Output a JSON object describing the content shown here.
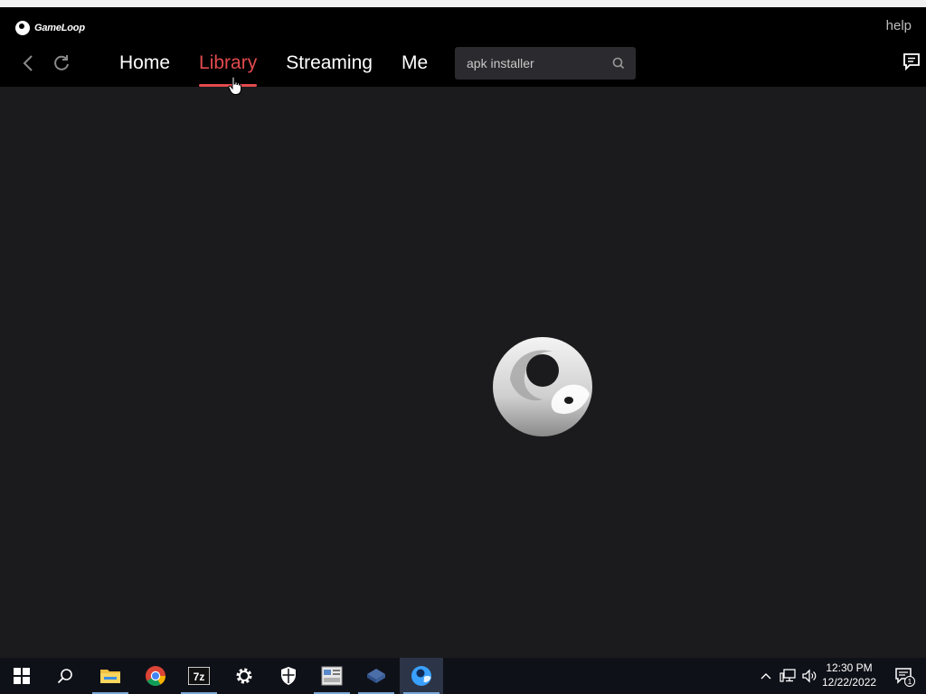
{
  "app": {
    "brand": "GameLoop",
    "help_label": "help",
    "accent_color": "#e24a4e"
  },
  "nav": {
    "tabs": [
      {
        "label": "Home",
        "active": false
      },
      {
        "label": "Library",
        "active": true
      },
      {
        "label": "Streaming",
        "active": false
      },
      {
        "label": "Me",
        "active": false
      }
    ],
    "back_icon": "chevron-left-icon",
    "refresh_icon": "refresh-icon",
    "chat_icon": "chat-icon"
  },
  "search": {
    "value": "apk installer",
    "icon": "search-icon"
  },
  "main": {
    "loading_icon": "gameloop-logo-spinner"
  },
  "taskbar": {
    "items": [
      {
        "icon": "windows-start-icon"
      },
      {
        "icon": "search-icon"
      },
      {
        "icon": "file-explorer-icon"
      },
      {
        "icon": "chrome-icon"
      },
      {
        "icon": "7zip-icon"
      },
      {
        "icon": "settings-icon"
      },
      {
        "icon": "windows-security-icon"
      },
      {
        "icon": "app-installer-icon"
      },
      {
        "icon": "virtualbox-icon"
      },
      {
        "icon": "gameloop-icon"
      }
    ],
    "clock": {
      "time": "12:30 PM",
      "date": "12/22/2022"
    },
    "notification_count": "1"
  }
}
